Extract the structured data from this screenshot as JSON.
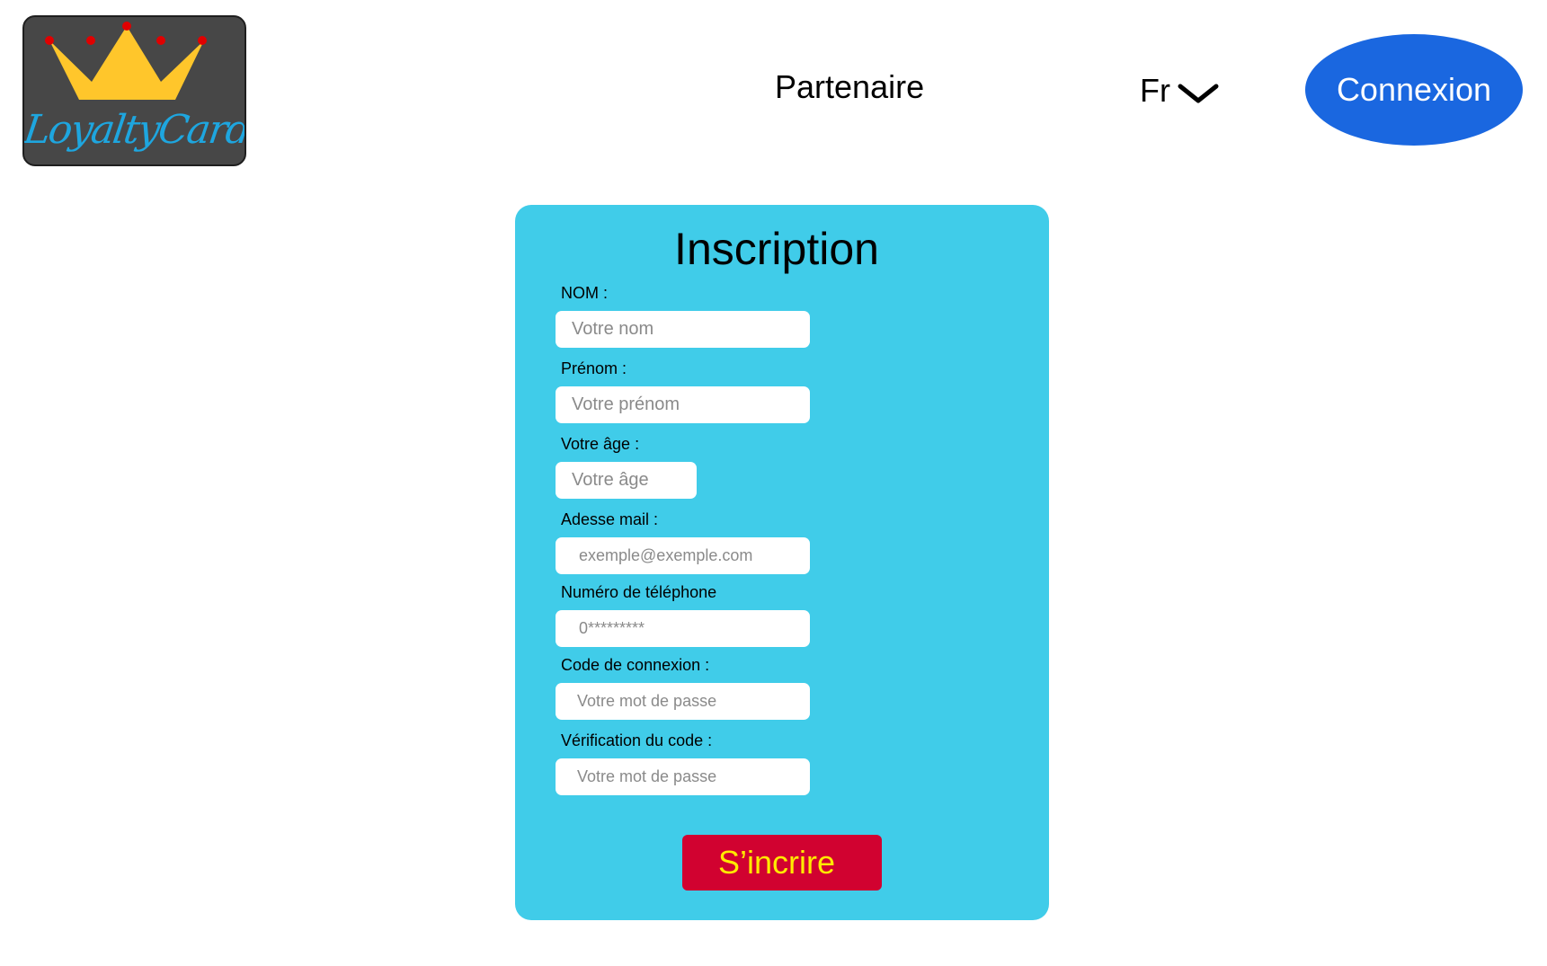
{
  "header": {
    "logo_text": "LoyaltyCard",
    "nav_partenaire": "Partenaire",
    "language": "Fr",
    "connexion_label": "Connexion"
  },
  "form": {
    "title": "Inscription",
    "fields": [
      {
        "label": "NOM :",
        "placeholder": "Votre nom"
      },
      {
        "label": "Prénom :",
        "placeholder": "Votre prénom"
      },
      {
        "label": "Votre âge :",
        "placeholder": "Votre âge"
      },
      {
        "label": "Adesse mail :",
        "placeholder": "exemple@exemple.com"
      },
      {
        "label": "Numéro de téléphone",
        "placeholder": "0*********"
      },
      {
        "label": "Code de connexion :",
        "placeholder": "Votre mot de passe"
      },
      {
        "label": "Vérification du code :",
        "placeholder": "Votre mot de passe"
      }
    ],
    "submit_label": "S’incrire"
  },
  "colors": {
    "logo_bg": "#474747",
    "crown": "#ffc62b",
    "crown_jewels": "#e00000",
    "logo_text": "#1ea6df",
    "connexion_bg": "#1a67e0",
    "card_bg": "#40cce9",
    "submit_bg": "#d10230",
    "submit_text": "#ffea00"
  }
}
